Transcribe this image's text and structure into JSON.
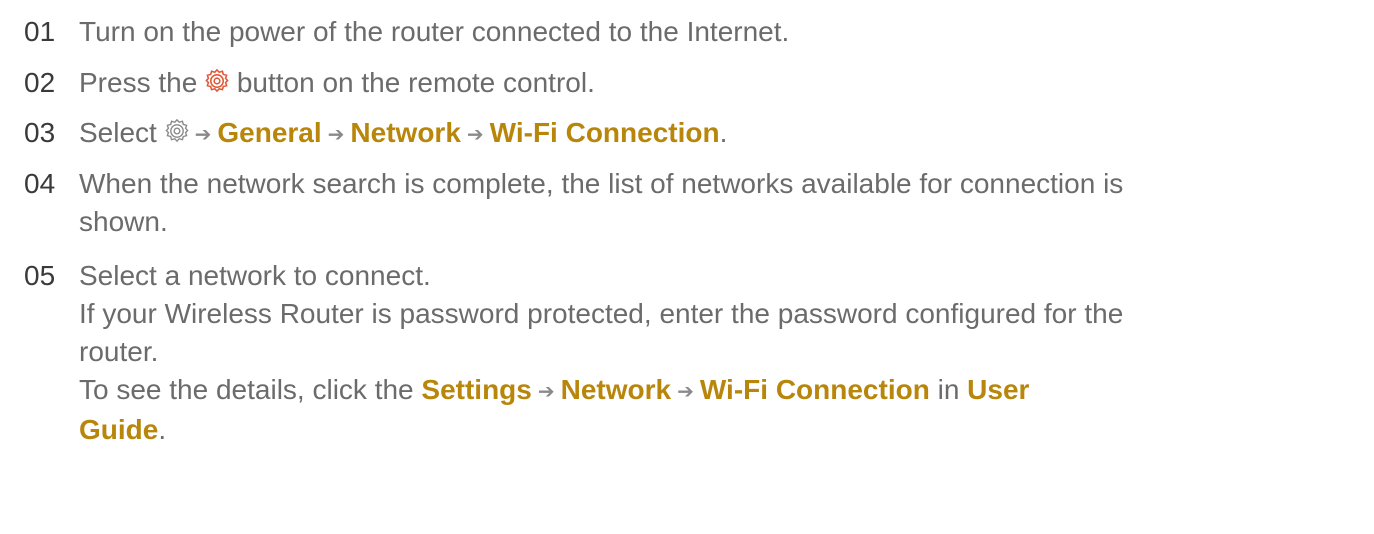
{
  "colors": {
    "text": "#6b6b6b",
    "number": "#3a3a3a",
    "highlight": "#b8860b",
    "gear_red": "#e05a3a",
    "gear_gray": "#8a8a8a"
  },
  "icons": {
    "settings_button": "gear-icon",
    "settings_menu": "gear-icon",
    "arrow": "right-arrow"
  },
  "steps": [
    {
      "num": "01",
      "text": "Turn on the power of the router connected to the Internet."
    },
    {
      "num": "02",
      "before": "Press the",
      "after": "button on the remote control."
    },
    {
      "num": "03",
      "before": "Select",
      "items": [
        "General",
        "Network",
        "Wi-Fi Connection"
      ],
      "end": "."
    },
    {
      "num": "04",
      "line1": "When the network search is complete, the list of networks available for connection is",
      "line2": "shown."
    },
    {
      "num": "05",
      "line1": "Select a network to connect.",
      "line2": "If your Wireless Router is password protected, enter the password configured for the",
      "line3": "router.",
      "line4_before": "To see the details, click the",
      "line4_items": [
        "Settings",
        "Network",
        "Wi-Fi Connection"
      ],
      "line4_in": "in",
      "line4_user": "User",
      "line5_guide": "Guide",
      "line5_end": "."
    }
  ]
}
